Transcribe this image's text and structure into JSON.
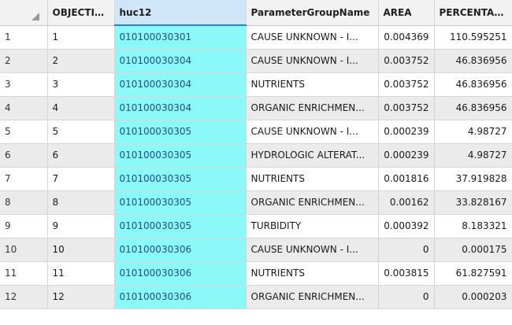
{
  "columns": {
    "objectid": "OBJECTID *",
    "huc12": "huc12",
    "param": "ParameterGroupName",
    "area": "AREA",
    "percentage": "PERCENTAGE"
  },
  "rows": [
    {
      "n": "1",
      "oid": "1",
      "huc": "010100030301",
      "param": "CAUSE UNKNOWN - I...",
      "area": "0.004369",
      "pct": "110.595251"
    },
    {
      "n": "2",
      "oid": "2",
      "huc": "010100030304",
      "param": "CAUSE UNKNOWN - I...",
      "area": "0.003752",
      "pct": "46.836956"
    },
    {
      "n": "3",
      "oid": "3",
      "huc": "010100030304",
      "param": "NUTRIENTS",
      "area": "0.003752",
      "pct": "46.836956"
    },
    {
      "n": "4",
      "oid": "4",
      "huc": "010100030304",
      "param": "ORGANIC ENRICHMEN...",
      "area": "0.003752",
      "pct": "46.836956"
    },
    {
      "n": "5",
      "oid": "5",
      "huc": "010100030305",
      "param": "CAUSE UNKNOWN - I...",
      "area": "0.000239",
      "pct": "4.98727"
    },
    {
      "n": "6",
      "oid": "6",
      "huc": "010100030305",
      "param": "HYDROLOGIC ALTERAT...",
      "area": "0.000239",
      "pct": "4.98727"
    },
    {
      "n": "7",
      "oid": "7",
      "huc": "010100030305",
      "param": "NUTRIENTS",
      "area": "0.001816",
      "pct": "37.919828"
    },
    {
      "n": "8",
      "oid": "8",
      "huc": "010100030305",
      "param": "ORGANIC ENRICHMEN...",
      "area": "0.00162",
      "pct": "33.828167"
    },
    {
      "n": "9",
      "oid": "9",
      "huc": "010100030305",
      "param": "TURBIDITY",
      "area": "0.000392",
      "pct": "8.183321"
    },
    {
      "n": "10",
      "oid": "10",
      "huc": "010100030306",
      "param": "CAUSE UNKNOWN - I...",
      "area": "0",
      "pct": "0.000175"
    },
    {
      "n": "11",
      "oid": "11",
      "huc": "010100030306",
      "param": "NUTRIENTS",
      "area": "0.003815",
      "pct": "61.827591"
    },
    {
      "n": "12",
      "oid": "12",
      "huc": "010100030306",
      "param": "ORGANIC ENRICHMEN...",
      "area": "0",
      "pct": "0.000203"
    }
  ]
}
